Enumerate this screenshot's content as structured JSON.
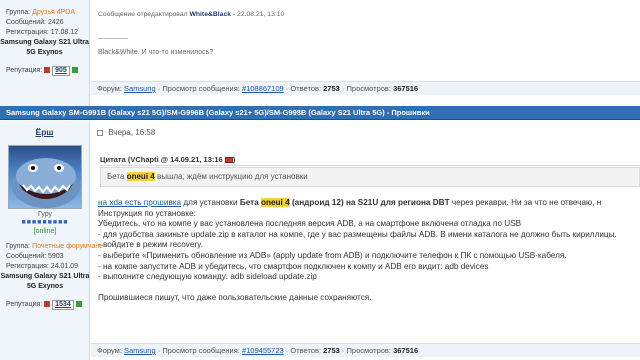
{
  "post1": {
    "group_label": "Группа:",
    "group_value": "Друзья 4PDA",
    "messages": "Сообщений: 2426",
    "registration": "Регистрация: 17.08.12",
    "device_line1": "Samsung Galaxy S21 Ultra",
    "device_line2": "5G Exynos",
    "reputation_label": "Репутация:",
    "reputation_value": "905",
    "edited_prefix": "Сообщение отредактировал",
    "edited_user": "White&Black",
    "edited_date": "- 22.08.21, 13:10",
    "text": "Black&White. И что-то изменилось?",
    "footer": {
      "forum_label": "Форум:",
      "forum_link": "Samsung",
      "views_label": "· Просмотр сообщения:",
      "post_link": "#108867109",
      "answers_label": "· Ответов:",
      "answers": "2753",
      "seen_label": "· Просмотров:",
      "seen": "367516"
    }
  },
  "topic_title": "Samsung Galaxy SM-G991B (Galaxy s21 5G)/SM-G996B (Galaxy s21+ 5G)/SM-G998B (Galaxy S21 Ultra 5G) - Прошивки",
  "post2": {
    "nick": "Ёрш",
    "date": "Вчера, 16:58",
    "rank": "Гуру",
    "status": "[online]",
    "group_label": "Группа:",
    "group_value": "Почетные форумчане",
    "messages": "Сообщений: 5903",
    "registration": "Регистрация: 24.01.09",
    "device_line1": "Samsung Galaxy S21 Ultra",
    "device_line2": "5G Exynos",
    "reputation_label": "Репутация:",
    "reputation_value": "1534",
    "quote_header": "Цитата (VChapti @ 14.09.21, 13:16",
    "quote_before": "Бета",
    "quote_highlight": "oneui 4",
    "quote_after": "вышла, ждём инструкцию для установки",
    "lines": {
      "l1_link": "на xda есть прошивка",
      "l1_mid": " для установки ",
      "l1_beta": "Бета ",
      "l1_hl": "oneui 4",
      "l1_bold": " (андроид 12) на S21U для региона DBT",
      "l1_end": " через рекаври. Ни за что не отвечаю, н",
      "l2": "Инструкция по установке:",
      "l3": "Убедитесь, что на компе у вас установлена последняя версия ADB, а на смартфоне включена отладка по USB",
      "l4": "- для удобства закиньте update.zip в каталог на компе, где у вас размещены файлы ADB. В имени каталога не должно быть кириллицы.",
      "l5": "- войдите в режим recovery.",
      "l6": "- выберите «Применить обновление из ADB» (apply update from ADB) и подключите телефон к ПК с помощью USB-кабеля.",
      "l7": "- на компе запустите ADB и убедитесь, что смартфон подключен к компу и ADB его видит: adb devices",
      "l8": "- выполните следующую команду: adb sideload update.zip",
      "l9": "Прошившиеся пишут, что даже пользовательские данные сохраняются."
    },
    "footer": {
      "forum_label": "Форум:",
      "forum_link": "Samsung",
      "views_label": "· Просмотр сообщения:",
      "post_link": "#109455723",
      "answers_label": "· Ответов:",
      "answers": "2753",
      "seen_label": "· Просмотров:",
      "seen": "367516"
    }
  },
  "colors": {
    "topic_bar": "#2f6fb4",
    "highlight": "#f5d23a",
    "link": "#1e5aa8",
    "rep_minus": "#c0392b",
    "rep_plus": "#3c9a3c"
  }
}
